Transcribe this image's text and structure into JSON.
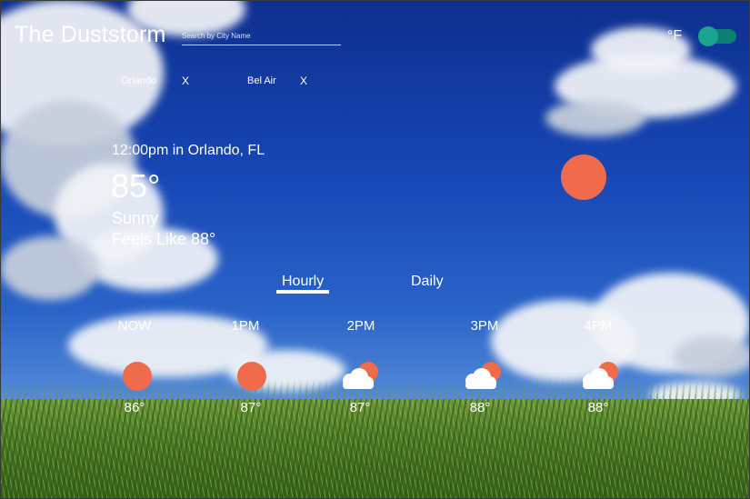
{
  "app": {
    "title": "The Duststorm"
  },
  "search": {
    "placeholder": "Search by City Name",
    "value": ""
  },
  "units": {
    "label": "°F",
    "toggle_on": true,
    "accent": "#1aa48f"
  },
  "saved_cities": [
    {
      "name": "Orlando",
      "remove_label": "X"
    },
    {
      "name": "Bel Air",
      "remove_label": "X"
    }
  ],
  "current": {
    "time_location": "12:00pm in Orlando, FL",
    "temperature": "85°",
    "condition": "Sunny",
    "feels_like": "Feels Like 88°",
    "icon": "sun-icon"
  },
  "tabs": [
    {
      "label": "Hourly",
      "active": true
    },
    {
      "label": "Daily",
      "active": false
    }
  ],
  "hourly": [
    {
      "label": "NOW",
      "temp": "86°",
      "icon": "sun-icon"
    },
    {
      "label": "1PM",
      "temp": "87°",
      "icon": "sun-icon"
    },
    {
      "label": "2PM",
      "temp": "87°",
      "icon": "partly-cloudy-icon"
    },
    {
      "label": "3PM",
      "temp": "88°",
      "icon": "partly-cloudy-icon"
    },
    {
      "label": "4PM",
      "temp": "88°",
      "icon": "partly-cloudy-icon"
    }
  ],
  "colors": {
    "sun": "#ef6b4b",
    "toggle_track": "#0f7e72"
  }
}
